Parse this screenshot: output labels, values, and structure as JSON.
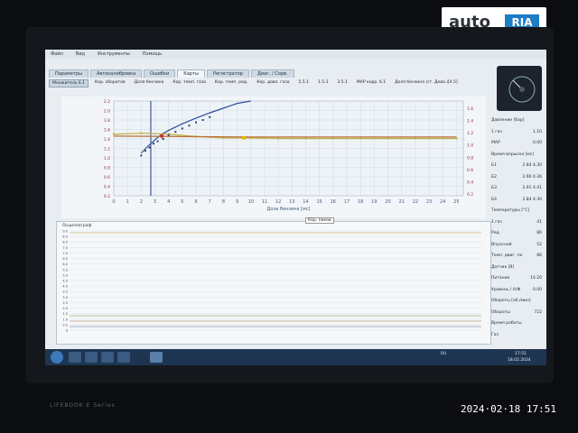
{
  "watermark": {
    "brand_left": "auto",
    "brand_right": "RIA"
  },
  "photo_timestamp": "2024·02·18  17:51",
  "laptop_brand": "LIFEBOOK E Series",
  "menu": [
    "Файл",
    "Вид",
    "Инструменты",
    "Помощь"
  ],
  "tabs": [
    {
      "label": "Параметры",
      "active": false
    },
    {
      "label": "Автокалибровка",
      "active": false
    },
    {
      "label": "Ошибки",
      "active": false
    },
    {
      "label": "Карты",
      "active": true
    },
    {
      "label": "Регистратор",
      "active": false
    },
    {
      "label": "Диаг. / Сорв.",
      "active": false
    }
  ],
  "subtabs": [
    {
      "label": "Множитель б.1",
      "active": true
    },
    {
      "label": "Кор. оборотов",
      "active": false
    },
    {
      "label": "Доля бензина",
      "active": false
    },
    {
      "label": "Кор. темп. газа",
      "active": false
    },
    {
      "label": "Кор. темп. ред.",
      "active": false
    },
    {
      "label": "Кор. давл. газа",
      "active": false
    },
    {
      "label": "5.5.1",
      "active": false
    },
    {
      "label": "1.5.1",
      "active": false
    },
    {
      "label": "3.5.1",
      "active": false
    },
    {
      "label": "MAP корр. б.1",
      "active": false
    },
    {
      "label": "Доля бензина (ст. Дева.)[4.5]",
      "active": false
    }
  ],
  "chart_data": {
    "type": "line",
    "xlabel": "Доза бензина [мс]",
    "x_ticks": [
      "0",
      "1",
      "2",
      "3",
      "4",
      "5",
      "6",
      "7",
      "8",
      "9",
      "10",
      "11",
      "12",
      "13",
      "14",
      "15",
      "16",
      "17",
      "18",
      "19",
      "20",
      "21",
      "22",
      "23",
      "24",
      "25"
    ],
    "y_left_ticks": [
      "2.2",
      "2.0",
      "1.8",
      "1.6",
      "1.4",
      "1.2",
      "1.0",
      "0.8",
      "0.6",
      "0.4",
      "0.2"
    ],
    "y_right_ticks": [
      "1.6",
      "1.4",
      "1.2",
      "1.0",
      "0.8",
      "0.6",
      "0.4",
      "0.2"
    ],
    "xlim": [
      0,
      25.5
    ],
    "ylim": [
      0.2,
      2.2
    ],
    "cursor_x": 2.7,
    "series": [
      {
        "color": "#2d4d9c",
        "x": [
          2,
          2.5,
          3,
          3.5,
          4,
          5,
          6,
          7,
          8,
          9,
          10
        ],
        "y": [
          1.1,
          1.25,
          1.38,
          1.5,
          1.58,
          1.72,
          1.84,
          1.95,
          2.05,
          2.15,
          2.22
        ]
      },
      {
        "color": "#c2b040",
        "x": [
          0,
          2,
          4,
          6,
          8,
          10,
          12,
          14,
          16,
          18,
          20,
          22,
          25
        ],
        "y": [
          1.5,
          1.52,
          1.5,
          1.45,
          1.42,
          1.42,
          1.41,
          1.41,
          1.41,
          1.41,
          1.41,
          1.41,
          1.41
        ]
      },
      {
        "color": "#b8703a",
        "x": [
          0,
          5,
          10,
          15,
          20,
          25
        ],
        "y": [
          1.46,
          1.45,
          1.44,
          1.44,
          1.44,
          1.44
        ]
      }
    ],
    "scatter": {
      "color": "#2b3f7d",
      "x": [
        2,
        2.3,
        2.6,
        2.9,
        3.2,
        3.6,
        4,
        4.5,
        5,
        5.5,
        6,
        6.5,
        7
      ],
      "y": [
        1.05,
        1.15,
        1.22,
        1.3,
        1.35,
        1.4,
        1.48,
        1.55,
        1.62,
        1.68,
        1.75,
        1.8,
        1.86
      ]
    },
    "markers": [
      {
        "x": 3.5,
        "y": 1.46,
        "color": "#c43a2f"
      },
      {
        "x": 9.5,
        "y": 1.42,
        "color": "#e2c000"
      }
    ]
  },
  "lower_chart": {
    "title": "Осциллограф",
    "y_ticks": [
      "9.0",
      "8.5",
      "8.0",
      "7.5",
      "7.0",
      "6.5",
      "6.0",
      "5.5",
      "5.0",
      "4.5",
      "4.0",
      "3.5",
      "3.0",
      "2.5",
      "2.0",
      "1.5",
      "1.0",
      "0.5",
      "0"
    ]
  },
  "right_panel": {
    "rows": [
      {
        "label": "Давление [бар]",
        "value": ""
      },
      {
        "label": "1 газ",
        "value": "1.10"
      },
      {
        "label": "MAP",
        "value": "0.00"
      },
      {
        "label": "Время впрыска [мс]",
        "value": ""
      },
      {
        "label": "Б1",
        "value": "2.84   4.30"
      },
      {
        "label": "Б2",
        "value": "2.90   4.36"
      },
      {
        "label": "Б3",
        "value": "2.91   4.41"
      },
      {
        "label": "Б4",
        "value": "2.84   4.30"
      },
      {
        "label": "Температуры [°C]",
        "value": ""
      },
      {
        "label": "1 газ",
        "value": "41"
      },
      {
        "label": "Ред.",
        "value": "86"
      },
      {
        "label": "Впускной",
        "value": "52"
      },
      {
        "label": "Темп. двиг. пе",
        "value": "86"
      },
      {
        "label": "Датчик [В]",
        "value": ""
      },
      {
        "label": "Питание",
        "value": "14.20"
      },
      {
        "label": "Уровень / А/Ф",
        "value": "0.00"
      },
      {
        "label": "Обороты [об./мин]",
        "value": ""
      },
      {
        "label": "Обороты",
        "value": "722"
      },
      {
        "label": "Время работы",
        "value": ""
      },
      {
        "label": "Газ",
        "value": ""
      }
    ]
  },
  "legend_chip": "Кор. пиков",
  "tray": {
    "lang": "RU",
    "time": "17:51",
    "date": "18.02.2024"
  },
  "colors": {
    "accent": "#1c7dc4",
    "chart_bg": "#f3f6f9",
    "taskbar": "#1e3552"
  }
}
